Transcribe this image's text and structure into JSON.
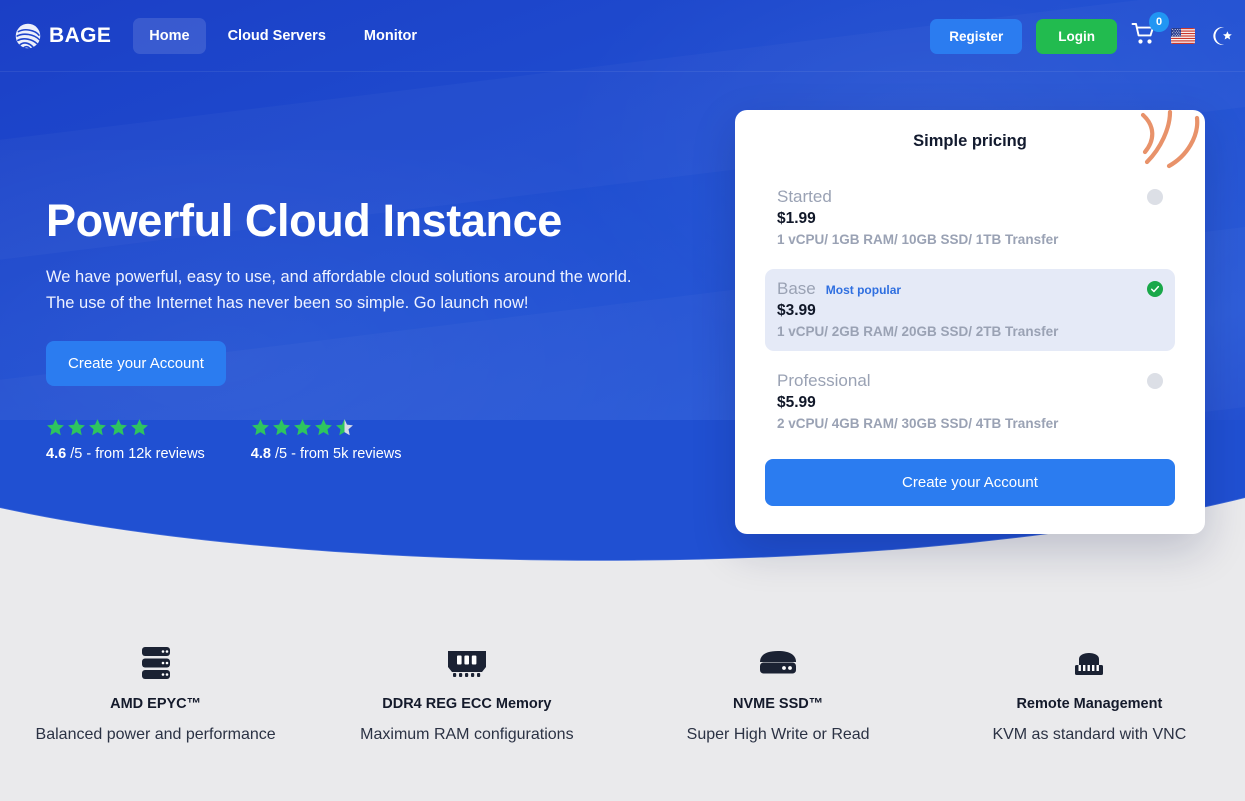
{
  "header": {
    "brand": {
      "name": "BAGE",
      "logo_icon": "globe-sphere-icon"
    },
    "nav": [
      {
        "label": "Home",
        "active": true
      },
      {
        "label": "Cloud Servers",
        "active": false
      },
      {
        "label": "Monitor",
        "active": false
      }
    ],
    "register_label": "Register",
    "login_label": "Login",
    "cart": {
      "icon": "shopping-cart-icon",
      "badge_count": "0"
    },
    "language": {
      "icon": "us-flag-icon",
      "label": "English (US)"
    },
    "theme_toggle": {
      "icon": "crescent-moon-star-icon"
    },
    "colors": {
      "register_bg": "#2b7cf0",
      "login_bg": "#22bb4f",
      "badge_bg": "#2196f3",
      "hero_blue": "#2050d2"
    }
  },
  "hero": {
    "title": "Powerful Cloud Instance",
    "subtitle_line1": "We have powerful, easy to use, and affordable cloud solutions around the world.",
    "subtitle_line2": "The use of the Internet has never been so simple. Go launch now!",
    "cta_label": "Create your Account",
    "ratings": [
      {
        "score": "4.6",
        "out_of": "/5",
        "separator": "-",
        "source": "from 12k reviews",
        "stars_full": 5,
        "stars_half": 0,
        "star_color": "#2ec45f"
      },
      {
        "score": "4.8",
        "out_of": "/5",
        "separator": "-",
        "source": "from 5k reviews",
        "stars_full": 4,
        "stars_half": 1,
        "star_color": "#2ec45f"
      }
    ]
  },
  "pricing": {
    "title": "Simple pricing",
    "decoration_icon": "orange-arcs-decoration",
    "plans": [
      {
        "name": "Started",
        "tag": "",
        "price": "$1.99",
        "specs": "1 vCPU/ 1GB RAM/ 10GB SSD/ 1TB Transfer",
        "selected": false
      },
      {
        "name": "Base",
        "tag": "Most popular",
        "price": "$3.99",
        "specs": "1 vCPU/ 2GB RAM/ 20GB SSD/ 2TB Transfer",
        "selected": true
      },
      {
        "name": "Professional",
        "tag": "",
        "price": "$5.99",
        "specs": "2 vCPU/ 4GB RAM/ 30GB SSD/ 4TB Transfer",
        "selected": false
      }
    ],
    "cta_label": "Create your Account",
    "colors": {
      "selected_bg": "#e5eaf7",
      "check_green": "#1aa84a",
      "tag_blue": "#2f6fe0",
      "cta_bg": "#2b7cf0"
    }
  },
  "features": [
    {
      "icon": "server-rack-icon",
      "title": "AMD EPYC™",
      "desc": "Balanced power and performance"
    },
    {
      "icon": "ram-stick-icon",
      "title": "DDR4 REG ECC Memory",
      "desc": "Maximum RAM configurations"
    },
    {
      "icon": "hard-drive-icon",
      "title": "NVME SSD™",
      "desc": "Super High Write or Read"
    },
    {
      "icon": "ethernet-port-icon",
      "title": "Remote Management",
      "desc": "KVM as standard with VNC"
    }
  ]
}
